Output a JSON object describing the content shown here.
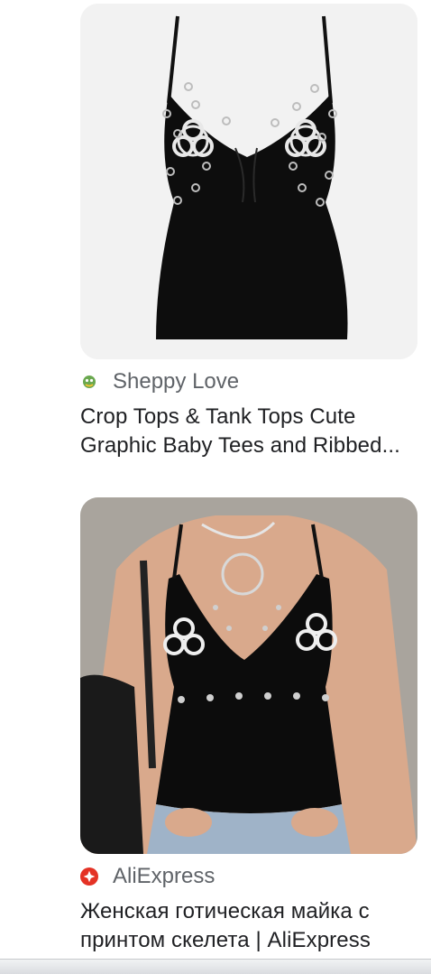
{
  "results": [
    {
      "source": "Sheppy Love",
      "favicon": "sheppy-love-favicon",
      "title_lines": [
        "Crop Tops & Tank Tops Cute",
        "Graphic Baby Tees and Ribbed..."
      ],
      "image": "black biohazard tank top product photo"
    },
    {
      "source": "AliExpress",
      "favicon": "aliexpress-favicon",
      "title_lines": [
        "Женская готическая майка с",
        "принтом скелета | AliExpress"
      ],
      "image": "model wearing black biohazard tank top"
    }
  ],
  "colors": {
    "background": "#ffffff",
    "source_text": "#5f6368",
    "title_text": "#202124",
    "aliexpress_red": "#e43225"
  }
}
